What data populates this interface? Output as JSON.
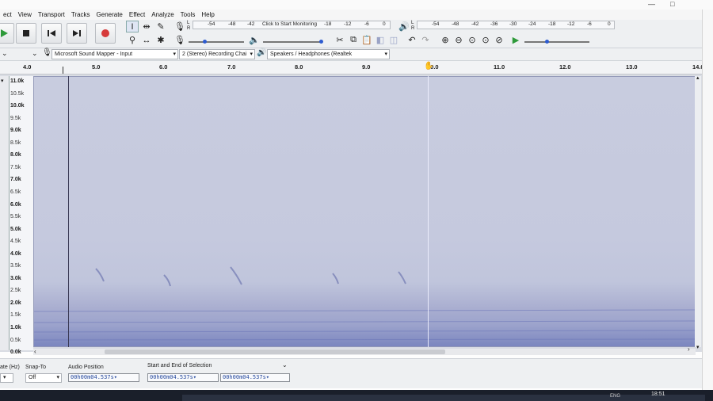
{
  "menu": [
    "ect",
    "View",
    "Transport",
    "Tracks",
    "Generate",
    "Effect",
    "Analyze",
    "Tools",
    "Help"
  ],
  "window_controls": {
    "minimize": "—",
    "maximize": "□"
  },
  "toolbar": {
    "record_meter_ticks": [
      "-54",
      "-48",
      "-42",
      "Click to Start Monitoring",
      "-18",
      "-12",
      "-6",
      "0"
    ],
    "playback_meter_ticks": [
      "-54",
      "-48",
      "-42",
      "-36",
      "-30",
      "-24",
      "-18",
      "-12",
      "-6",
      "0"
    ],
    "meter_lr": [
      "L",
      "R"
    ]
  },
  "devices": {
    "input": "Microsoft Sound Mapper - Input",
    "channels": "2 (Stereo) Recording Chai",
    "output": "Speakers / Headphones (Realtek"
  },
  "ruler": [
    "4.0",
    "5.0",
    "6.0",
    "7.0",
    "8.0",
    "9.0",
    "10.0",
    "11.0",
    "12.0",
    "13.0",
    "14.0"
  ],
  "freq_labels": [
    {
      "t": "11.0k",
      "major": true
    },
    {
      "t": "10.5k",
      "major": false
    },
    {
      "t": "10.0k",
      "major": true
    },
    {
      "t": "9.5k",
      "major": false
    },
    {
      "t": "9.0k",
      "major": true
    },
    {
      "t": "8.5k",
      "major": false
    },
    {
      "t": "8.0k",
      "major": true
    },
    {
      "t": "7.5k",
      "major": false
    },
    {
      "t": "7.0k",
      "major": true
    },
    {
      "t": "6.5k",
      "major": false
    },
    {
      "t": "6.0k",
      "major": true
    },
    {
      "t": "5.5k",
      "major": false
    },
    {
      "t": "5.0k",
      "major": true
    },
    {
      "t": "4.5k",
      "major": false
    },
    {
      "t": "4.0k",
      "major": true
    },
    {
      "t": "3.5k",
      "major": false
    },
    {
      "t": "3.0k",
      "major": true
    },
    {
      "t": "2.5k",
      "major": false
    },
    {
      "t": "2.0k",
      "major": true
    },
    {
      "t": "1.5k",
      "major": false
    },
    {
      "t": "1.0k",
      "major": true
    },
    {
      "t": "0.5k",
      "major": false
    },
    {
      "t": "0.0k",
      "major": true
    }
  ],
  "selection": {
    "rate_label": "ate (Hz)",
    "snap_label": "Snap-To",
    "snap_value": "Off",
    "audio_position_label": "Audio Position",
    "start_end_label": "Start and End of Selection",
    "audio_position": "00h00m04.537s",
    "selection_start": "00h00m04.537s",
    "selection_end": "00h00m04.537s"
  },
  "taskbar": {
    "clock": "18:51",
    "lang": "ENG"
  },
  "colors": {
    "spectrogram": "#c5c9de",
    "selection_text": "#274a9e",
    "record": "#d63a3a",
    "play": "#2e9a3a"
  }
}
